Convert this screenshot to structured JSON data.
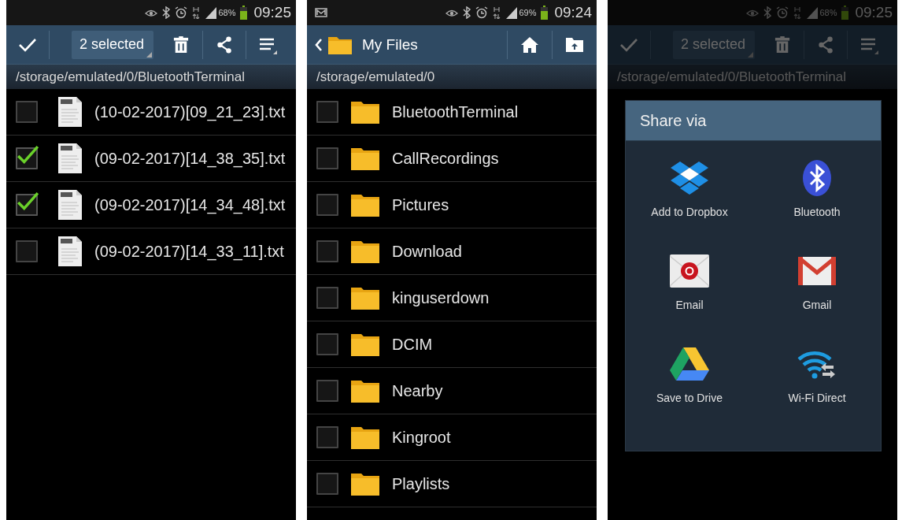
{
  "screens": [
    {
      "kind": "selection",
      "status_bar": {
        "notification": false,
        "battery": "68%",
        "time": "09:25"
      },
      "toolbar": {
        "selection": "2 selected"
      },
      "path": "/storage/emulated/0/BluetoothTerminal",
      "files": [
        {
          "name": "(10-02-2017)[09_21_23].txt",
          "checked": false
        },
        {
          "name": "(09-02-2017)[14_38_35].txt",
          "checked": true
        },
        {
          "name": "(09-02-2017)[14_34_48].txt",
          "checked": true
        },
        {
          "name": "(09-02-2017)[14_33_11].txt",
          "checked": false
        }
      ]
    },
    {
      "kind": "browser",
      "status_bar": {
        "notification": true,
        "battery": "69%",
        "time": "09:24"
      },
      "toolbar": {
        "title": "My Files"
      },
      "path": "/storage/emulated/0",
      "folders": [
        {
          "name": "BluetoothTerminal",
          "checked": false
        },
        {
          "name": "CallRecordings",
          "checked": false
        },
        {
          "name": "Pictures",
          "checked": false
        },
        {
          "name": "Download",
          "checked": false
        },
        {
          "name": "kinguserdown",
          "checked": false
        },
        {
          "name": "DCIM",
          "checked": false
        },
        {
          "name": "Nearby",
          "checked": false
        },
        {
          "name": "Kingroot",
          "checked": false
        },
        {
          "name": "Playlists",
          "checked": false
        }
      ]
    },
    {
      "kind": "share",
      "status_bar": {
        "notification": false,
        "battery": "68%",
        "time": "09:25"
      },
      "toolbar": {
        "selection": "2 selected"
      },
      "path": "/storage/emulated/0/BluetoothTerminal",
      "dialog": {
        "title": "Share via",
        "targets": [
          {
            "kind": "dropbox",
            "label": "Add to Dropbox"
          },
          {
            "kind": "bluetooth",
            "label": "Bluetooth"
          },
          {
            "kind": "email",
            "label": "Email"
          },
          {
            "kind": "gmail",
            "label": "Gmail"
          },
          {
            "kind": "drive",
            "label": "Save to Drive"
          },
          {
            "kind": "wifi-direct",
            "label": "Wi-Fi Direct"
          }
        ]
      }
    }
  ]
}
